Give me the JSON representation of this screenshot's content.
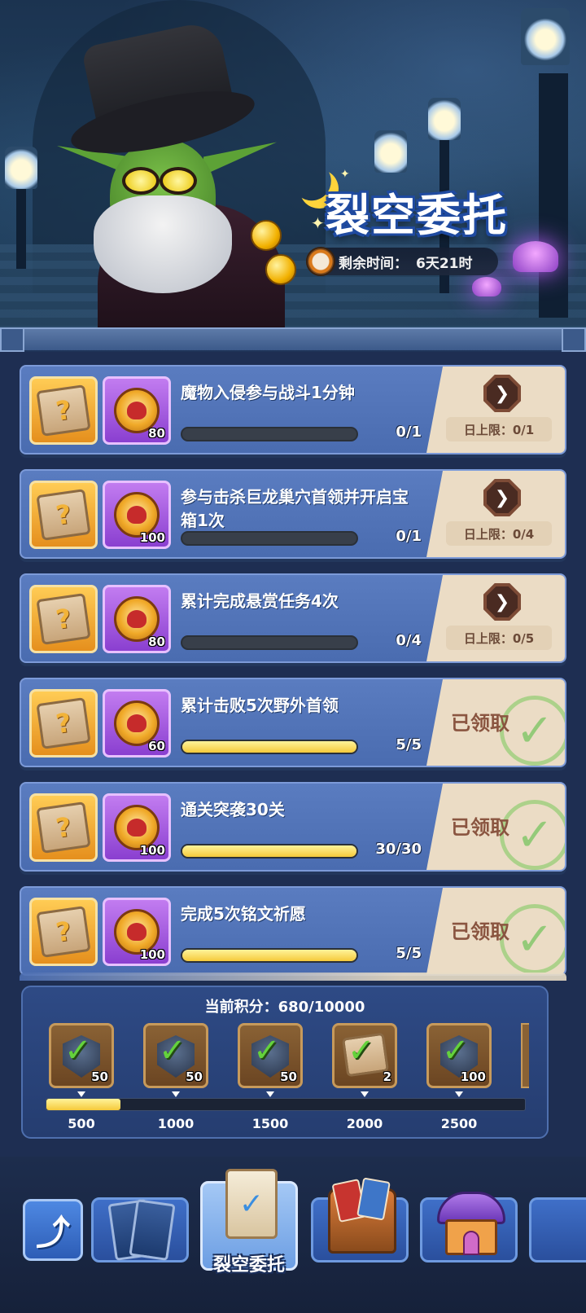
{
  "event": {
    "title": "裂空委托",
    "timer_label": "剩余时间：",
    "timer_value": "6天21时"
  },
  "quests": [
    {
      "title": "魔物入侵参与战斗1分钟",
      "reward_count": "80",
      "progress_text": "0/1",
      "progress": 0.0,
      "status": "go",
      "go_icon": "right-arrow",
      "daily_limit": "日上限：0/1"
    },
    {
      "title": "参与击杀巨龙巢穴首领并开启宝箱1次",
      "reward_count": "100",
      "progress_text": "0/1",
      "progress": 0.0,
      "status": "go",
      "go_icon": "right-arrow",
      "daily_limit": "日上限：0/4"
    },
    {
      "title": "累计完成悬赏任务4次",
      "reward_count": "80",
      "progress_text": "0/4",
      "progress": 0.0,
      "status": "go",
      "go_icon": "right-arrow",
      "daily_limit": "日上限：0/5"
    },
    {
      "title": "累计击败5次野外首领",
      "reward_count": "60",
      "progress_text": "5/5",
      "progress": 1.0,
      "status": "claimed",
      "claimed_label": "已领取"
    },
    {
      "title": "通关突袭30关",
      "reward_count": "100",
      "progress_text": "30/30",
      "progress": 1.0,
      "status": "claimed",
      "claimed_label": "已领取"
    },
    {
      "title": "完成5次铭文祈愿",
      "reward_count": "100",
      "progress_text": "5/5",
      "progress": 1.0,
      "status": "claimed",
      "claimed_label": "已领取"
    }
  ],
  "score": {
    "label": "当前积分：680/10000",
    "current": 680,
    "max": 10000,
    "track_progress": 0.155,
    "milestones": [
      {
        "threshold": "500",
        "count": "50",
        "icon": "armor-badge-icon",
        "claimed": true
      },
      {
        "threshold": "1000",
        "count": "50",
        "icon": "armor-badge-icon",
        "claimed": true
      },
      {
        "threshold": "1500",
        "count": "50",
        "icon": "armor-badge-icon",
        "claimed": true
      },
      {
        "threshold": "2000",
        "count": "2",
        "icon": "quest-scroll-icon",
        "claimed": true
      },
      {
        "threshold": "2500",
        "count": "100",
        "icon": "armor-badge-icon",
        "claimed": true
      }
    ]
  },
  "nav": {
    "back_icon": "back-arrow",
    "active_tab_label": "裂空委托",
    "tabs": [
      {
        "icon": "cards-icon"
      },
      {
        "icon": "commission-scroll-icon",
        "active": true
      },
      {
        "icon": "card-chest-icon"
      },
      {
        "icon": "shop-house-icon"
      }
    ]
  },
  "colors": {
    "panel_blue": "#4a6cb0",
    "progress_yellow": "#f5c93a",
    "claimed_green": "#64d23c",
    "side_beige": "#ebdcc5"
  }
}
